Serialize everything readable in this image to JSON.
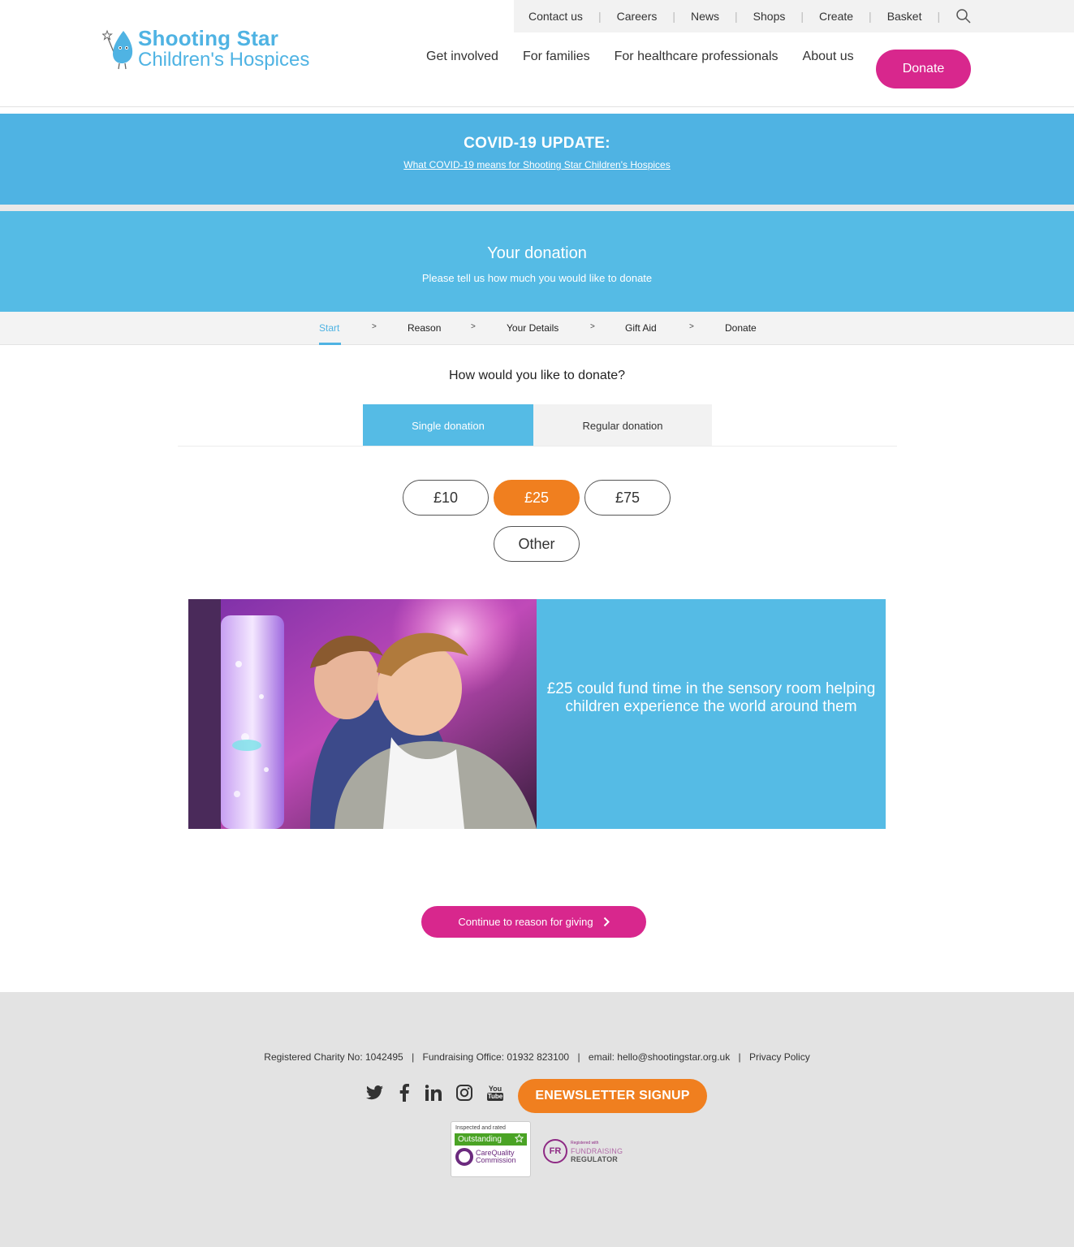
{
  "colors": {
    "brand_blue": "#4fb3e3",
    "banner_blue": "#55bbe5",
    "donate_pink": "#d8278d",
    "accent_orange": "#f07f1f",
    "footer_grey": "#e3e3e3"
  },
  "header": {
    "logo": {
      "line1": "Shooting Star",
      "line2": "Children's Hospices"
    },
    "utility_nav": [
      "Contact us",
      "Careers",
      "News",
      "Shops",
      "Create",
      "Basket"
    ],
    "main_nav": [
      "Get involved",
      "For families",
      "For healthcare professionals",
      "About us"
    ],
    "donate_label": "Donate"
  },
  "covid": {
    "title": "COVID-19 UPDATE:",
    "link": "What COVID-19 means for Shooting Star Children's Hospices"
  },
  "donation_header": {
    "title": "Your donation",
    "subtitle": "Please tell us how much you would like to donate"
  },
  "steps": {
    "items": [
      "Start",
      "Reason",
      "Your Details",
      "Gift Aid",
      "Donate"
    ],
    "active": "Start",
    "separator": ">"
  },
  "donate_type": {
    "question": "How would you like to donate?",
    "tabs": [
      "Single donation",
      "Regular donation"
    ],
    "active_tab": "Single donation"
  },
  "amounts": {
    "options": [
      "£10",
      "£25",
      "£75",
      "Other"
    ],
    "selected": "£25"
  },
  "impact": {
    "text": "£25 could fund time in the sensory room helping children experience the world around them"
  },
  "continue_label": "Continue to reason for giving",
  "footer": {
    "charity_no": "Registered Charity No: 1042495",
    "fundraising_office": "Fundraising Office: 01932 823100",
    "email": "email: hello@shootingstar.org.uk",
    "privacy": "Privacy Policy",
    "separator": "|",
    "social_icons": [
      "twitter-icon",
      "facebook-icon",
      "linkedin-icon",
      "instagram-icon",
      "youtube-icon"
    ],
    "youtube_top": "You",
    "youtube_bottom": "Tube",
    "newsletter_label": "ENEWSLETTER SIGNUP",
    "cqc": {
      "top": "Inspected and rated",
      "rating": "Outstanding",
      "name_line1": "CareQuality",
      "name_line2": "Commission"
    },
    "fr": {
      "mark": "FR",
      "small": "Registered with",
      "line1": "FUNDRAISING",
      "line2": "REGULATOR"
    }
  }
}
